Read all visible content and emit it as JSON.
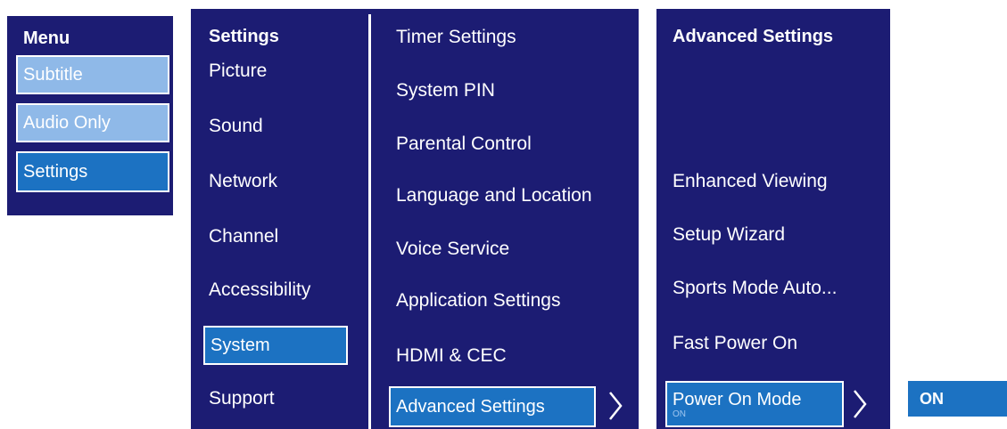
{
  "menu": {
    "title": "Menu",
    "items": [
      {
        "label": "Subtitle"
      },
      {
        "label": "Audio Only"
      },
      {
        "label": "Settings"
      }
    ]
  },
  "settings": {
    "title": "Settings",
    "items": [
      {
        "label": "Picture"
      },
      {
        "label": "Sound"
      },
      {
        "label": "Network"
      },
      {
        "label": "Channel"
      },
      {
        "label": "Accessibility"
      },
      {
        "label": "System"
      },
      {
        "label": "Support"
      }
    ]
  },
  "system": {
    "items": [
      {
        "label": "Timer Settings"
      },
      {
        "label": "System PIN"
      },
      {
        "label": "Parental Control"
      },
      {
        "label": "Language and Location"
      },
      {
        "label": "Voice Service"
      },
      {
        "label": "Application Settings"
      },
      {
        "label": "HDMI & CEC"
      },
      {
        "label": "Advanced Settings"
      }
    ]
  },
  "advanced": {
    "title": "Advanced Settings",
    "items": [
      {
        "label": "Enhanced Viewing"
      },
      {
        "label": "Setup Wizard"
      },
      {
        "label": "Sports Mode Auto..."
      },
      {
        "label": "Fast Power On"
      },
      {
        "label": "Power On Mode",
        "sub": "ON"
      }
    ]
  },
  "power_on_mode": {
    "value": "ON"
  },
  "colors": {
    "panel": "#1c1c73",
    "light_button": "#8fb9e8",
    "selected_button": "#1c72c2"
  },
  "icons": [
    "chevron-right-icon"
  ]
}
